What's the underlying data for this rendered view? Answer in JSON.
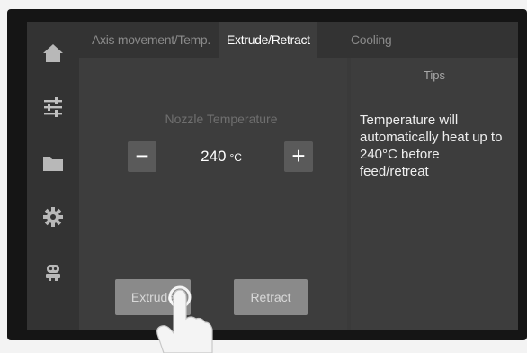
{
  "sidebar": {
    "items": [
      {
        "name": "home",
        "icon": "home-icon"
      },
      {
        "name": "settings",
        "icon": "sliders-icon"
      },
      {
        "name": "files",
        "icon": "folder-icon"
      },
      {
        "name": "system",
        "icon": "gear-icon"
      },
      {
        "name": "about",
        "icon": "robot-icon"
      }
    ]
  },
  "tabs": [
    {
      "label": "Axis movement/Temp.",
      "active": false
    },
    {
      "label": "Extrude/Retract",
      "active": true
    },
    {
      "label": "Cooling",
      "active": false
    }
  ],
  "nozzle": {
    "label": "Nozzle Temperature",
    "value": "240",
    "unit": "°C",
    "decrease": "−",
    "increase": "+"
  },
  "actions": {
    "extrude": "Extrude",
    "retract": "Retract"
  },
  "tips": {
    "title": "Tips",
    "body": "Temperature will automatically heat up to 240°C before feed/retreat"
  },
  "colors": {
    "screen_bg": "#3d3d3d",
    "sidebar_bg": "#333333",
    "bezel": "#151515",
    "button": "#8a8a8a"
  }
}
